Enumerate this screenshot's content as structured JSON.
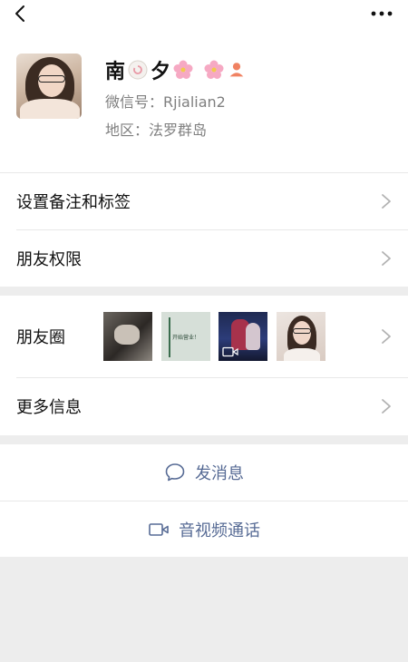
{
  "colors": {
    "link_blue": "#576b95",
    "page_bg": "#ededed",
    "card_bg": "#ffffff",
    "secondary_text": "#7f7f7f"
  },
  "nav": {
    "back_icon": "chevron-left-icon",
    "more_icon": "more-dots-icon"
  },
  "profile": {
    "nickname_part1": "南",
    "nickname_part2": "夕",
    "emojis": [
      "fishcake-emoji",
      "cherry-blossom-emoji",
      "cherry-blossom-emoji"
    ],
    "gender_icon": "female-icon",
    "wechat_id": "微信号：Rjialian2",
    "region": "地区：法罗群岛"
  },
  "menu": {
    "remark_tags": "设置备注和标签",
    "permissions": "朋友权限",
    "moments": "朋友圈",
    "moments_thumbnails": [
      "moments-photo-1",
      "moments-photo-2",
      "moments-video-3",
      "moments-photo-4"
    ],
    "moments_thumb2_text": "开始营业！",
    "more_info": "更多信息"
  },
  "actions": {
    "message": "发消息",
    "av_call": "音视频通话"
  }
}
